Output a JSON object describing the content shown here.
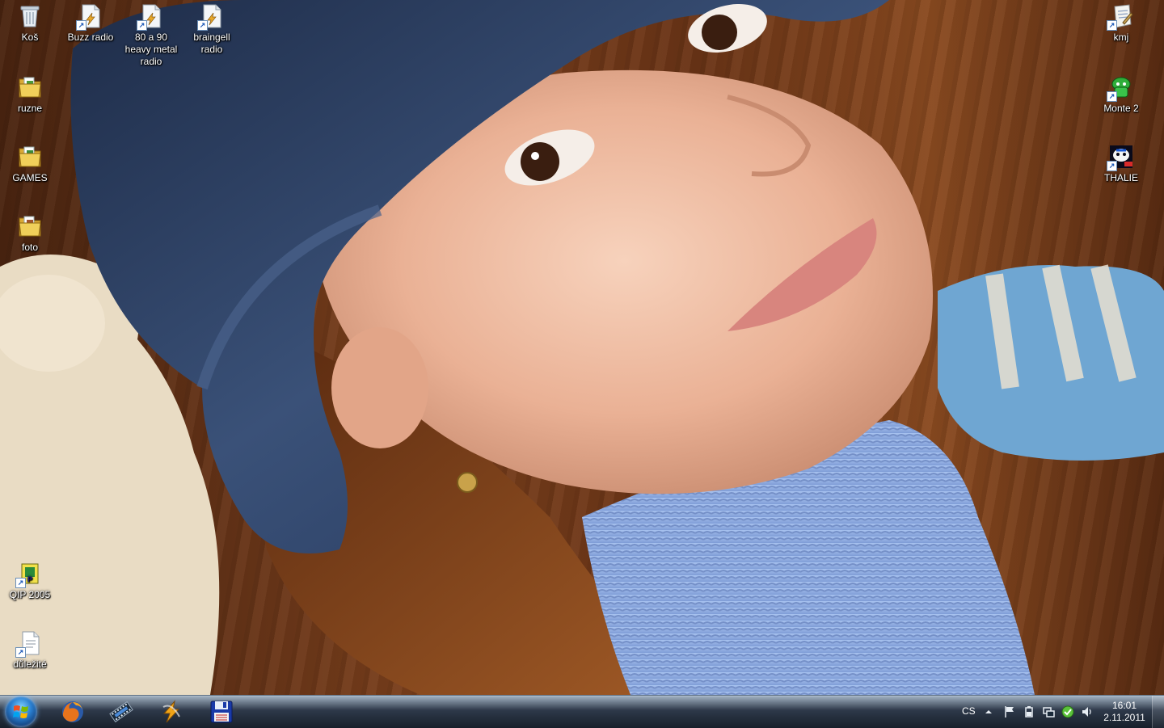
{
  "desktop": {
    "icons_left": [
      {
        "label": "Koš",
        "icon": "recycle-bin-icon"
      },
      {
        "label": "Buzz radio",
        "icon": "winamp-playlist-icon"
      },
      {
        "label": "80 a 90 heavy metal radio",
        "icon": "winamp-playlist-icon"
      },
      {
        "label": "braingell radio",
        "icon": "winamp-playlist-icon"
      },
      {
        "label": "ruzne",
        "icon": "folder-icon"
      },
      {
        "label": "GAMES",
        "icon": "folder-icon"
      },
      {
        "label": "foto",
        "icon": "folder-icon"
      },
      {
        "label": "QIP 2005",
        "icon": "qip-icon"
      },
      {
        "label": "důležité",
        "icon": "document-shortcut-icon"
      }
    ],
    "icons_right": [
      {
        "label": "kmj",
        "icon": "notepad-shortcut-icon"
      },
      {
        "label": "Monte 2",
        "icon": "game-shortcut-icon"
      },
      {
        "label": "THALIE",
        "icon": "theater-shortcut-icon"
      }
    ]
  },
  "taskbar": {
    "pinned": [
      {
        "name": "firefox",
        "icon": "firefox-icon"
      },
      {
        "name": "media",
        "icon": "film-strip-icon"
      },
      {
        "name": "winamp",
        "icon": "winamp-icon"
      },
      {
        "name": "save",
        "icon": "floppy-disk-icon"
      }
    ],
    "tray": {
      "language": "CS",
      "icons": [
        "show-hidden-arrow-icon",
        "action-center-flag-icon",
        "power-icon",
        "network-icon",
        "antivirus-icon",
        "volume-icon"
      ]
    },
    "clock": {
      "time": "16:01",
      "date": "2.11.2011"
    }
  },
  "colors": {
    "taskbar_dark": "#0e1622",
    "start_orb": "#2a7fd0",
    "folder_yellow": "#e8c14a",
    "wallpaper_wood": "#6a3416",
    "sweater_blue": "#9cb7e6",
    "cap_denim": "#2c3e63"
  }
}
